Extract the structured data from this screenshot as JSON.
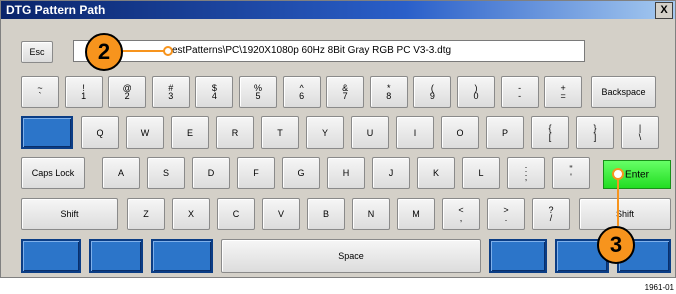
{
  "window": {
    "title": "DTG Pattern Path",
    "close_label": "X"
  },
  "path_field": {
    "value": "estPatterns\\PC\\1920X1080p 60Hz 8Bit Gray RGB PC V3-3.dtg"
  },
  "keys": {
    "esc": "Esc",
    "backspace": "Backspace",
    "caps_lock": "Caps Lock",
    "enter": "Enter",
    "shift_left": "Shift",
    "shift_right": "Shift",
    "space": "Space",
    "number_row": [
      {
        "top": "~",
        "bottom": "`"
      },
      {
        "top": "!",
        "bottom": "1"
      },
      {
        "top": "@",
        "bottom": "2"
      },
      {
        "top": "#",
        "bottom": "3"
      },
      {
        "top": "$",
        "bottom": "4"
      },
      {
        "top": "%",
        "bottom": "5"
      },
      {
        "top": "^",
        "bottom": "6"
      },
      {
        "top": "&",
        "bottom": "7"
      },
      {
        "top": "*",
        "bottom": "8"
      },
      {
        "top": "(",
        "bottom": "9"
      },
      {
        "top": ")",
        "bottom": "0"
      },
      {
        "top": "-",
        "bottom": "-"
      },
      {
        "top": "+",
        "bottom": "="
      }
    ],
    "qwerty_row": [
      {
        "label": "Q"
      },
      {
        "label": "W"
      },
      {
        "label": "E"
      },
      {
        "label": "R"
      },
      {
        "label": "T"
      },
      {
        "label": "Y"
      },
      {
        "label": "U"
      },
      {
        "label": "I"
      },
      {
        "label": "O"
      },
      {
        "label": "P"
      },
      {
        "top": "{",
        "bottom": "["
      },
      {
        "top": "}",
        "bottom": "]"
      },
      {
        "top": "|",
        "bottom": "\\"
      }
    ],
    "home_row": [
      {
        "label": "A"
      },
      {
        "label": "S"
      },
      {
        "label": "D"
      },
      {
        "label": "F"
      },
      {
        "label": "G"
      },
      {
        "label": "H"
      },
      {
        "label": "J"
      },
      {
        "label": "K"
      },
      {
        "label": "L"
      },
      {
        "top": ":",
        "bottom": ";"
      },
      {
        "top": "\"",
        "bottom": "'"
      }
    ],
    "bottom_row": [
      {
        "label": "Z"
      },
      {
        "label": "X"
      },
      {
        "label": "C"
      },
      {
        "label": "V"
      },
      {
        "label": "B"
      },
      {
        "label": "N"
      },
      {
        "label": "M"
      },
      {
        "top": "<",
        "bottom": ","
      },
      {
        "top": ">",
        "bottom": "."
      },
      {
        "top": "?",
        "bottom": "/"
      }
    ]
  },
  "callouts": {
    "first": "2",
    "second": "3"
  },
  "colors": {
    "accent_callout": "#f7941d",
    "enter_key": "#33ee33",
    "blue_key": "#2c75c9",
    "title_bar": "#0a246a"
  },
  "figure_id": "1961-01"
}
